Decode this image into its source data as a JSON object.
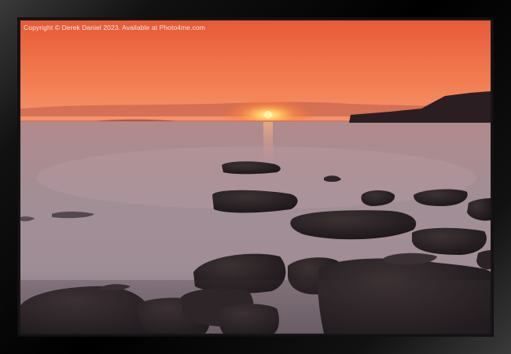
{
  "watermark": {
    "text": "Copyright © Derek Daniel 2023. Available at Photo4me.com"
  },
  "photo": {
    "subject": "sunset-over-sea-with-rocks",
    "colors": {
      "sky_top": "#e8603a",
      "sky_horizon": "#f5906a",
      "sun": "#ffd36b",
      "sea": "#a89096",
      "rock": "#2a2224"
    }
  },
  "frame": {
    "color": "#000000"
  }
}
